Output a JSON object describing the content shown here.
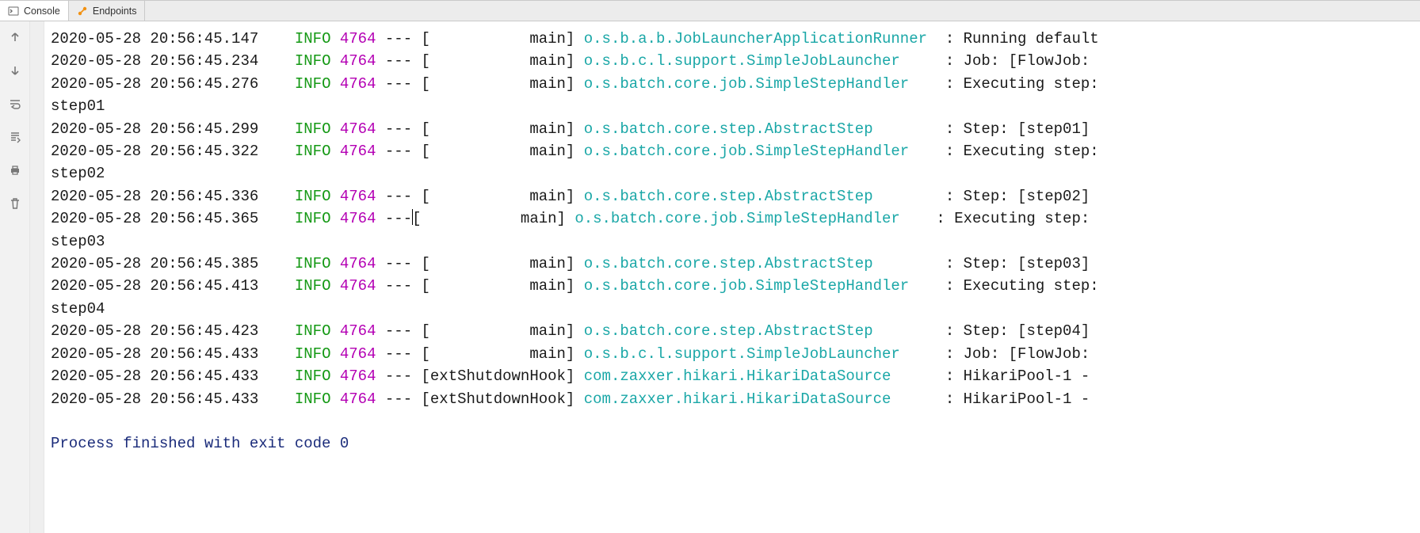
{
  "tabs": {
    "console": "Console",
    "endpoints": "Endpoints"
  },
  "log_lines": [
    {
      "ts": "2020-05-28 20:56:45.147",
      "level": "INFO",
      "pid": "4764",
      "thread": "           main",
      "logger": "o.s.b.a.b.JobLauncherApplicationRunner",
      "msg": "Running default"
    },
    {
      "ts": "2020-05-28 20:56:45.234",
      "level": "INFO",
      "pid": "4764",
      "thread": "           main",
      "logger": "o.s.b.c.l.support.SimpleJobLauncher",
      "msg": "Job: [FlowJob:"
    },
    {
      "ts": "2020-05-28 20:56:45.276",
      "level": "INFO",
      "pid": "4764",
      "thread": "           main",
      "logger": "o.s.batch.core.job.SimpleStepHandler",
      "msg": "Executing step:"
    },
    {
      "raw": "step01"
    },
    {
      "ts": "2020-05-28 20:56:45.299",
      "level": "INFO",
      "pid": "4764",
      "thread": "           main",
      "logger": "o.s.batch.core.step.AbstractStep",
      "msg": "Step: [step01]"
    },
    {
      "ts": "2020-05-28 20:56:45.322",
      "level": "INFO",
      "pid": "4764",
      "thread": "           main",
      "logger": "o.s.batch.core.job.SimpleStepHandler",
      "msg": "Executing step:"
    },
    {
      "raw": "step02"
    },
    {
      "ts": "2020-05-28 20:56:45.336",
      "level": "INFO",
      "pid": "4764",
      "thread": "           main",
      "logger": "o.s.batch.core.step.AbstractStep",
      "msg": "Step: [step02]"
    },
    {
      "ts": "2020-05-28 20:56:45.365",
      "level": "INFO",
      "pid": "4764",
      "thread": "           main",
      "logger": "o.s.batch.core.job.SimpleStepHandler",
      "msg": "Executing step:",
      "caret_before_thread": true
    },
    {
      "raw": "step03"
    },
    {
      "ts": "2020-05-28 20:56:45.385",
      "level": "INFO",
      "pid": "4764",
      "thread": "           main",
      "logger": "o.s.batch.core.step.AbstractStep",
      "msg": "Step: [step03]"
    },
    {
      "ts": "2020-05-28 20:56:45.413",
      "level": "INFO",
      "pid": "4764",
      "thread": "           main",
      "logger": "o.s.batch.core.job.SimpleStepHandler",
      "msg": "Executing step:"
    },
    {
      "raw": "step04"
    },
    {
      "ts": "2020-05-28 20:56:45.423",
      "level": "INFO",
      "pid": "4764",
      "thread": "           main",
      "logger": "o.s.batch.core.step.AbstractStep",
      "msg": "Step: [step04]"
    },
    {
      "ts": "2020-05-28 20:56:45.433",
      "level": "INFO",
      "pid": "4764",
      "thread": "           main",
      "logger": "o.s.b.c.l.support.SimpleJobLauncher",
      "msg": "Job: [FlowJob:"
    },
    {
      "ts": "2020-05-28 20:56:45.433",
      "level": "INFO",
      "pid": "4764",
      "thread": "extShutdownHook",
      "logger": "com.zaxxer.hikari.HikariDataSource",
      "msg": "HikariPool-1 -"
    },
    {
      "ts": "2020-05-28 20:56:45.433",
      "level": "INFO",
      "pid": "4764",
      "thread": "extShutdownHook",
      "logger": "com.zaxxer.hikari.HikariDataSource",
      "msg": "HikariPool-1 -"
    }
  ],
  "process_finish": "Process finished with exit code 0",
  "columns": {
    "ts_width": 25,
    "level_width": 5,
    "pid_width": 4,
    "logger_width": 39
  }
}
